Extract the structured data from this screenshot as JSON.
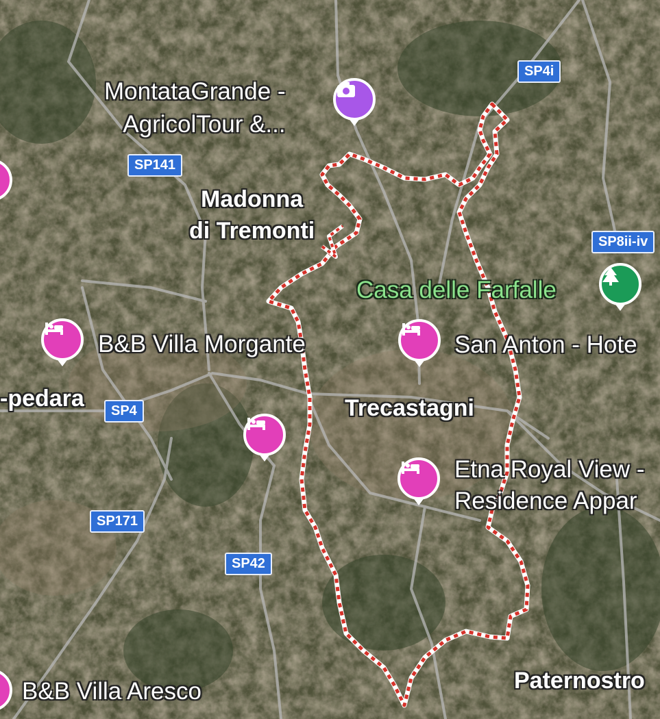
{
  "map": {
    "town_labels": [
      {
        "id": "madonna",
        "text": "Madonna\ndi Tremonti"
      },
      {
        "id": "trecastagni",
        "text": "Trecastagni"
      },
      {
        "id": "pedara",
        "text": "-pedara"
      },
      {
        "id": "paternostro",
        "text": "Paternostro"
      }
    ],
    "poi_labels": [
      {
        "id": "montata",
        "text": "MontataGrande -\nAgricolTour &..."
      },
      {
        "id": "farfalle",
        "text": "Casa delle Farfalle"
      },
      {
        "id": "villa-morgante",
        "text": "B&B Villa Morgante"
      },
      {
        "id": "san-anton",
        "text": "San Anton - Hote"
      },
      {
        "id": "etna-royal",
        "text": "Etna Royal View -\nResidence Appar"
      },
      {
        "id": "villa-aresco",
        "text": "B&B Villa Aresco"
      }
    ],
    "road_shields": [
      "SP4i",
      "SP141",
      "SP8ii-iv",
      "SP4",
      "SP171",
      "SP42"
    ],
    "markers": [
      {
        "id": "montata-pin",
        "icon": "camera-icon",
        "color": "#a857e8"
      },
      {
        "id": "farfalle-pin",
        "icon": "tree-icon",
        "color": "#1b9b57"
      },
      {
        "id": "villa-morgante-pin",
        "icon": "bed-icon",
        "color": "#e23fb9"
      },
      {
        "id": "san-anton-pin",
        "icon": "bed-icon",
        "color": "#e23fb9"
      },
      {
        "id": "unnamed-hotel-pin",
        "icon": "bed-icon",
        "color": "#e23fb9"
      },
      {
        "id": "etna-royal-pin",
        "icon": "bed-icon",
        "color": "#e23fb9"
      },
      {
        "id": "left-edge-hotel-pin-top",
        "icon": "bed-icon",
        "color": "#e23fb9"
      },
      {
        "id": "left-edge-hotel-pin-bottom",
        "icon": "bed-icon",
        "color": "#e23fb9"
      }
    ],
    "boundary": {
      "name": "municipal-boundary",
      "style": "red-white dashed",
      "colors": [
        "#d6322a",
        "#ffffff"
      ]
    }
  }
}
